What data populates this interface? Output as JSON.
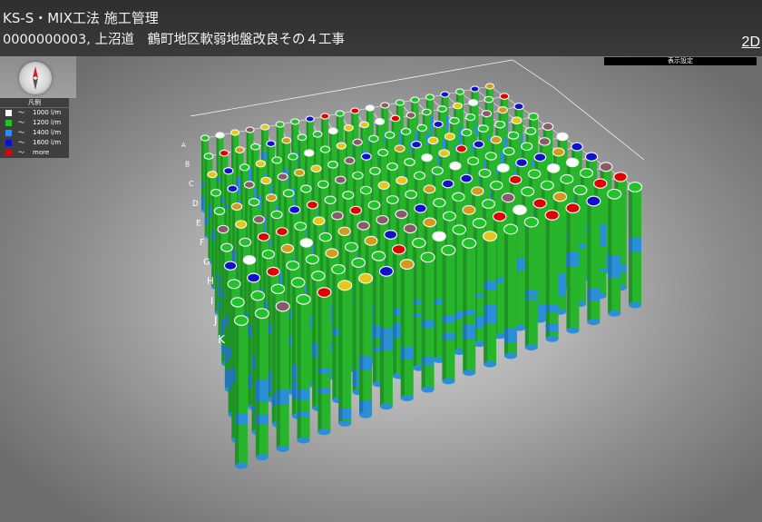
{
  "header": {
    "app_title": "KS-S・MIX工法 施工管理",
    "project_title": "0000000003, 上沼道　鶴町地区軟弱地盤改良その４工事"
  },
  "toolbar": {
    "view_2d_label": "2D",
    "display_settings_label": "表示設定"
  },
  "compass": {
    "icon": "compass-icon"
  },
  "legend": {
    "title": "凡例",
    "items": [
      {
        "tilde": "〜",
        "label": "1000 l/m",
        "color": "#ffffff"
      },
      {
        "tilde": "〜",
        "label": "1200 l/m",
        "color": "#22c32a"
      },
      {
        "tilde": "〜",
        "label": "1400 l/m",
        "color": "#1e90ff"
      },
      {
        "tilde": "〜",
        "label": "1600 l/m",
        "color": "#1010cc"
      },
      {
        "tilde": "〜",
        "label": "more",
        "color": "#e00000"
      }
    ]
  },
  "grid": {
    "row_labels": [
      "A",
      "B",
      "C",
      "D",
      "E",
      "F",
      "G",
      "H",
      "I",
      "J",
      "K"
    ]
  }
}
